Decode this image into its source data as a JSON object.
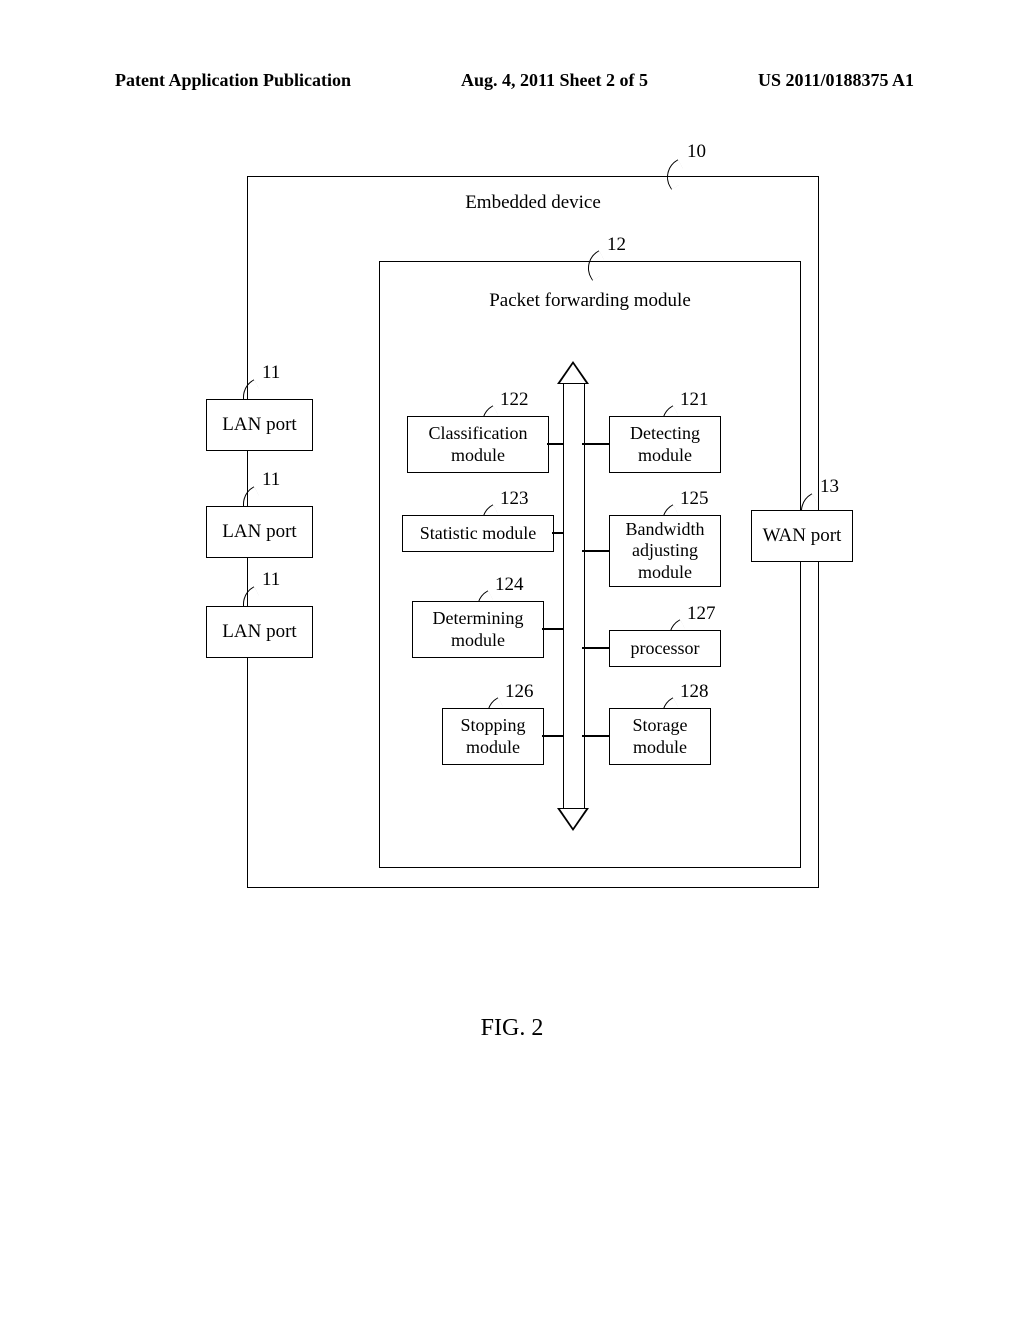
{
  "header": {
    "left": "Patent Application Publication",
    "middle": "Aug. 4, 2011  Sheet 2 of 5",
    "right": "US 2011/0188375 A1"
  },
  "refs": {
    "r10": "10",
    "r11a": "11",
    "r11b": "11",
    "r11c": "11",
    "r12": "12",
    "r13": "13",
    "r121": "121",
    "r122": "122",
    "r123": "123",
    "r124": "124",
    "r125": "125",
    "r126": "126",
    "r127": "127",
    "r128": "128"
  },
  "boxes": {
    "embedded": "Embedded device",
    "forwarding": "Packet forwarding module",
    "lan": "LAN port",
    "wan": "WAN port",
    "classification": "Classification module",
    "detecting": "Detecting module",
    "statistic": "Statistic module",
    "bandwidth_l1": "Bandwidth",
    "bandwidth_l2": "adjusting",
    "bandwidth_l3": "module",
    "determining": "Determining module",
    "processor": "processor",
    "stopping": "Stopping module",
    "storage": "Storage module"
  },
  "figure": "FIG.   2"
}
